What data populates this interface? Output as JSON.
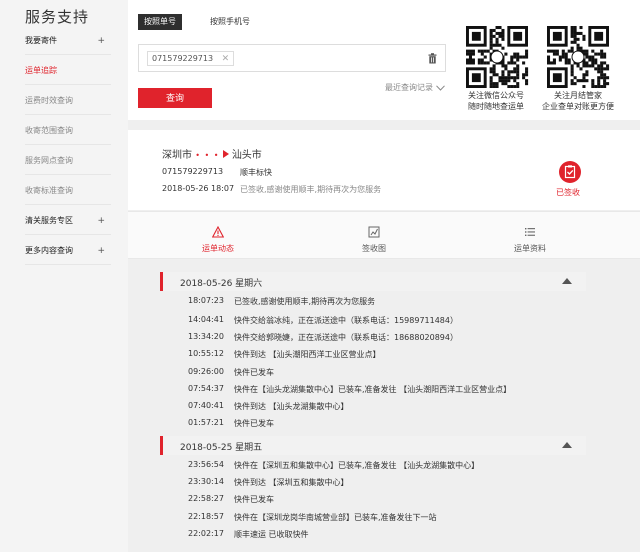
{
  "sidebar": {
    "title": "服务支持",
    "items": [
      {
        "label": "我要寄件",
        "plus": "+"
      },
      {
        "label": "运单追踪"
      },
      {
        "label": "运费时效查询"
      },
      {
        "label": "收寄范围查询"
      },
      {
        "label": "服务网点查询"
      },
      {
        "label": "收寄标准查询"
      },
      {
        "label": "清关服务专区",
        "plus": "+"
      },
      {
        "label": "更多内容查询",
        "plus": "+"
      }
    ]
  },
  "search": {
    "tab_waybill": "按照单号",
    "tab_phone": "按照手机号",
    "chip_value": "071579229713",
    "chip_close": "✕",
    "recent": "最近查询记录",
    "query_button": "查询"
  },
  "qr": {
    "wechat_caption_1": "关注微信公众号",
    "wechat_caption_2": "随时随地查运单",
    "yuejie_caption_1": "关注月结管家",
    "yuejie_caption_2": "企业查单对账更方便"
  },
  "result": {
    "from": "深圳市",
    "dots": "• • •",
    "to": "汕头市",
    "waybill": "071579229713",
    "product": "顺丰标快",
    "datetime": "2018-05-26 18:07",
    "status_text": "已签收,感谢使用顺丰,期待再次为您服务",
    "signed_label": "已签收"
  },
  "detail_tabs": {
    "dynamics": "运单动态",
    "receipt": "签收图",
    "info": "运单资料"
  },
  "days": [
    {
      "header": "2018-05-26 星期六",
      "events": [
        {
          "time": "18:07:23",
          "desc": "已签收,感谢使用顺丰,期待再次为您服务"
        },
        {
          "time": "14:04:41",
          "desc": "快件交给翁冰纯，正在派送途中（联系电话：15989711484）"
        },
        {
          "time": "13:34:20",
          "desc": "快件交给郭晓婕，正在派送途中（联系电话：18688020894）"
        },
        {
          "time": "10:55:12",
          "desc": "快件到达 【汕头潮阳西洋工业区营业点】"
        },
        {
          "time": "09:26:00",
          "desc": "快件已发车"
        },
        {
          "time": "07:54:37",
          "desc": "快件在【汕头龙湖集散中心】已装车,准备发往 【汕头潮阳西洋工业区营业点】"
        },
        {
          "time": "07:40:41",
          "desc": "快件到达 【汕头龙湖集散中心】"
        },
        {
          "time": "01:57:21",
          "desc": "快件已发车"
        }
      ]
    },
    {
      "header": "2018-05-25 星期五",
      "events": [
        {
          "time": "23:56:54",
          "desc": "快件在【深圳五和集散中心】已装车,准备发往 【汕头龙湖集散中心】"
        },
        {
          "time": "23:30:14",
          "desc": "快件到达 【深圳五和集散中心】"
        },
        {
          "time": "22:58:27",
          "desc": "快件已发车"
        },
        {
          "time": "22:18:57",
          "desc": "快件在【深圳龙岗华南城营业部】已装车,准备发往下一站"
        },
        {
          "time": "22:02:17",
          "desc": "顺丰速运 已收取快件"
        }
      ]
    }
  ],
  "colors": {
    "accent": "#e0232c",
    "dark_tab": "#2f2f2f"
  },
  "icons": {
    "trash": "trash-icon",
    "dynamics": "warning-triangle-icon",
    "receipt": "signature-icon",
    "info": "list-icon",
    "signed": "check-clipboard-icon"
  }
}
